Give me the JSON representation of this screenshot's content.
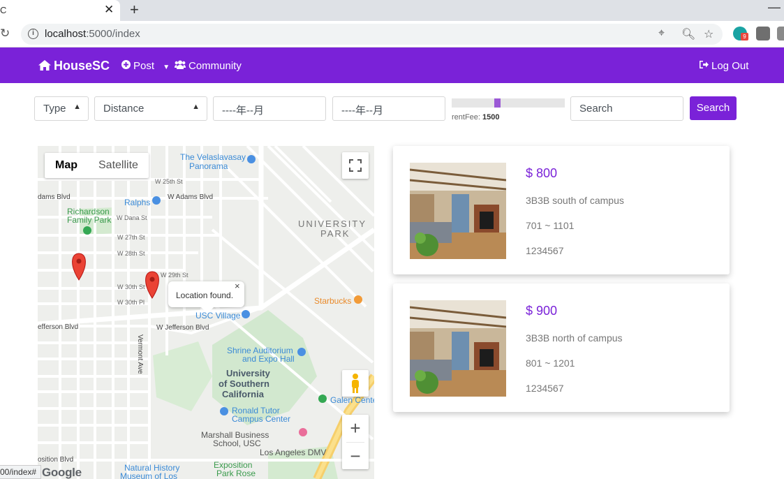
{
  "browser": {
    "tab_title": "C",
    "tab_close": "✕",
    "new_tab": "+",
    "minimize": "—",
    "url_host": "localhost",
    "url_path": ":5000/index",
    "extension_badge": "9"
  },
  "navbar": {
    "brand": "HouseSC",
    "brand_icon": "home-icon",
    "items": [
      {
        "label": "Post",
        "icon": "plus-circle-icon"
      },
      {
        "label": "Community",
        "icon": "users-icon"
      }
    ],
    "logout": "Log Out"
  },
  "filters": {
    "type": "Type",
    "distance": "Distance",
    "date_from": "----年--月",
    "date_to": "----年--月",
    "rent_label": "rentFee:",
    "rent_value": "1500",
    "rent_fraction": 0.4,
    "search_placeholder": "Search",
    "search_button": "Search"
  },
  "map": {
    "map_button": "Map",
    "satellite_button": "Satellite",
    "info_window": "Location found.",
    "info_close": "×",
    "zoom_in": "+",
    "zoom_out": "−",
    "labels": [
      "The Velaslavasay",
      "Panorama",
      "Ralphs",
      "Richardson",
      "Family Park",
      "UNIVERSITY",
      "PARK",
      "Starbucks",
      "USC Village",
      "Shrine Auditorium",
      "and Expo Hall",
      "University",
      "of Southern",
      "California",
      "Ronald Tutor",
      "Campus Center",
      "Marshall Business",
      "School, USC",
      "Los Angeles DMV",
      "Galen Cente",
      "Natural History",
      "Museum of Los",
      "Exposition",
      "Park Rose",
      "W 25th St",
      "W Adams Blvd",
      "W Dana St",
      "W 27th St",
      "W 28th St",
      "W 29th St",
      "W 30th St",
      "W 30th Pl",
      "W Jefferson Blvd",
      "dams Blvd",
      "efferson Blvd",
      "osition Blvd",
      "Vermont Ave"
    ],
    "google": "Google",
    "status_url": "00/index#"
  },
  "listings": [
    {
      "price": "$ 800",
      "title": "3B3B south of campus",
      "range": "701 ~ 1101",
      "phone": "1234567"
    },
    {
      "price": "$ 900",
      "title": "3B3B north of campus",
      "range": "801 ~ 1201",
      "phone": "1234567"
    }
  ],
  "colors": {
    "brand": "#7a22d8",
    "map_marker": "#ea4335"
  }
}
